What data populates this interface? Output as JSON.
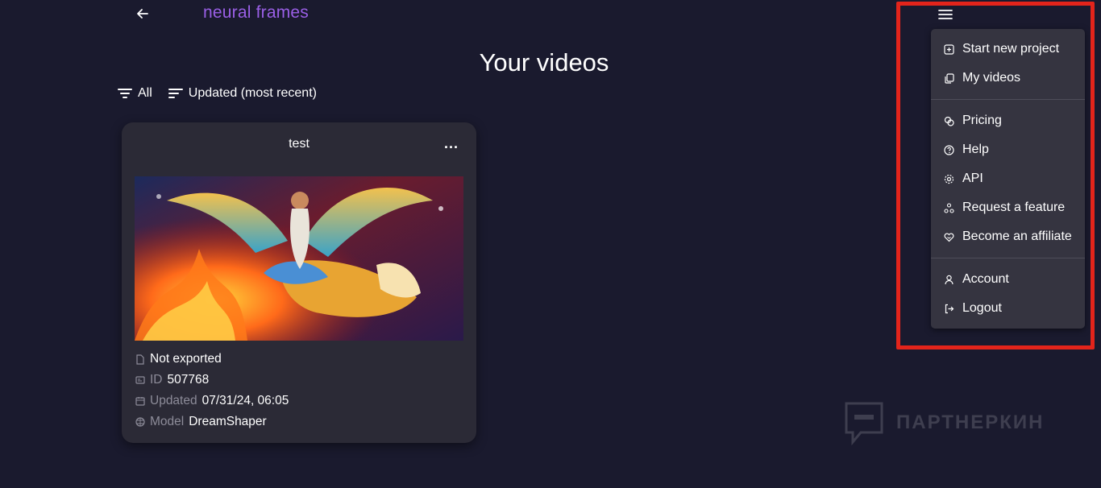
{
  "header": {
    "logo": "neural frames"
  },
  "page": {
    "title": "Your videos"
  },
  "filters": {
    "type_label": "All",
    "sort_label": "Updated (most recent)"
  },
  "video": {
    "title": "test",
    "menu_glyph": "...",
    "status": "Not exported",
    "id_label": "ID",
    "id": "507768",
    "updated_label": "Updated",
    "updated": "07/31/24, 06:05",
    "model_label": "Model",
    "model": "DreamShaper"
  },
  "menu": {
    "items": [
      {
        "label": "Start new project",
        "icon": "plus-square-icon"
      },
      {
        "label": "My videos",
        "icon": "copy-icon"
      },
      {
        "label": "Pricing",
        "icon": "coins-icon"
      },
      {
        "label": "Help",
        "icon": "help-circle-icon"
      },
      {
        "label": "API",
        "icon": "gear-icon"
      },
      {
        "label": "Request a feature",
        "icon": "shapes-icon"
      },
      {
        "label": "Become an affiliate",
        "icon": "heart-handshake-icon"
      },
      {
        "label": "Account",
        "icon": "user-icon"
      },
      {
        "label": "Logout",
        "icon": "logout-icon"
      }
    ]
  },
  "watermark": {
    "text": "ПАРТНЕРКИН"
  },
  "colors": {
    "background": "#1a1a2e",
    "card": "#2b2a36",
    "menu": "#353440",
    "logo": "#9a5fe6",
    "highlight": "#e3241b"
  }
}
